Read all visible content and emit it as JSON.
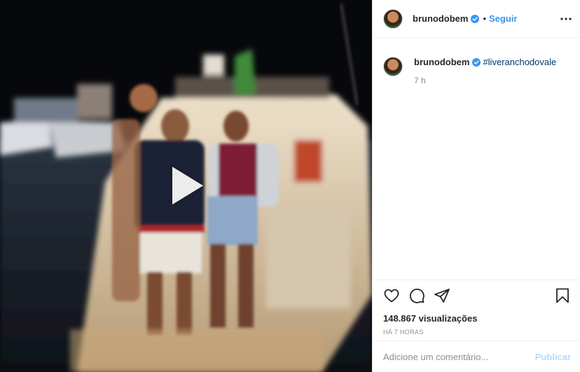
{
  "post": {
    "username": "brunodobem",
    "follow_label": "Seguir",
    "separator": "•",
    "caption_hashtag": "#liveranchodovale",
    "caption_time": "7 h",
    "views": "148.867 visualizações",
    "posted_ago": "HÁ 7 HORAS"
  },
  "comment": {
    "placeholder": "Adicione um comentário...",
    "publish_label": "Publicar"
  },
  "colors": {
    "accent": "#3897f0",
    "hashtag": "#00376b",
    "publish_disabled": "#b3dbff",
    "muted": "#8e8e8e"
  },
  "icons": {
    "verified": "verified-badge-icon",
    "more": "more-options-icon",
    "like": "heart-icon",
    "comment": "comment-icon",
    "share": "share-icon",
    "save": "bookmark-icon",
    "play": "play-icon"
  }
}
